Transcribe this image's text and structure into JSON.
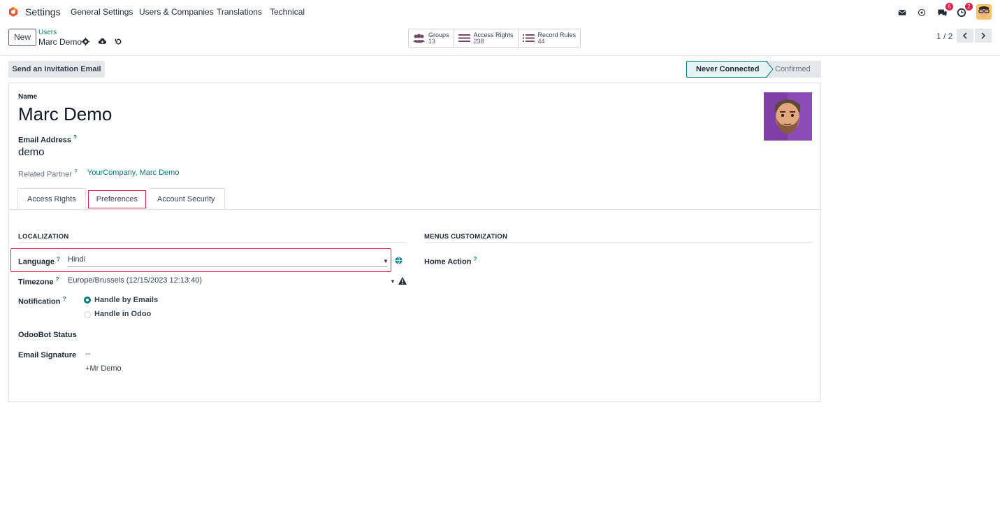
{
  "navbar": {
    "app_name": "Settings",
    "menus": [
      "General Settings",
      "Users & Companies",
      "Translations",
      "Technical"
    ],
    "messages_badge": "6",
    "activity_badge": "2"
  },
  "control": {
    "new_label": "New",
    "breadcrumb_parent": "Users",
    "breadcrumb_current": "Marc Demo",
    "smart_buttons": [
      {
        "label": "Groups",
        "value": "13",
        "icon": "users-icon"
      },
      {
        "label": "Access Rights",
        "value": "238",
        "icon": "list-icon"
      },
      {
        "label": "Record Rules",
        "value": "44",
        "icon": "list-icon"
      }
    ],
    "pager": "1 / 2"
  },
  "statusbar": {
    "invite_label": "Send an Invitation Email",
    "stages": [
      "Never Connected",
      "Confirmed"
    ]
  },
  "form": {
    "name_label": "Name",
    "name_value": "Marc Demo",
    "email_label": "Email Address",
    "email_value": "demo",
    "partner_label": "Related Partner",
    "partner_value": "YourCompany, Marc Demo",
    "help_mark": "?",
    "tabs": [
      "Access Rights",
      "Preferences",
      "Account Security"
    ],
    "localization_title": "LOCALIZATION",
    "menus_title": "MENUS CUSTOMIZATION",
    "language_label": "Language",
    "language_value": "Hindi",
    "timezone_label": "Timezone",
    "timezone_value": "Europe/Brussels (12/15/2023 12:13:40)",
    "notification_label": "Notification",
    "notification_options": [
      "Handle by Emails",
      "Handle in Odoo"
    ],
    "odoobot_label": "OdooBot Status",
    "signature_label": "Email Signature",
    "signature_lines": [
      "--",
      "+Mr Demo"
    ],
    "home_action_label": "Home Action"
  },
  "colors": {
    "accent": "#017e84",
    "brand": "#714b67",
    "highlight": "#e11d48"
  }
}
